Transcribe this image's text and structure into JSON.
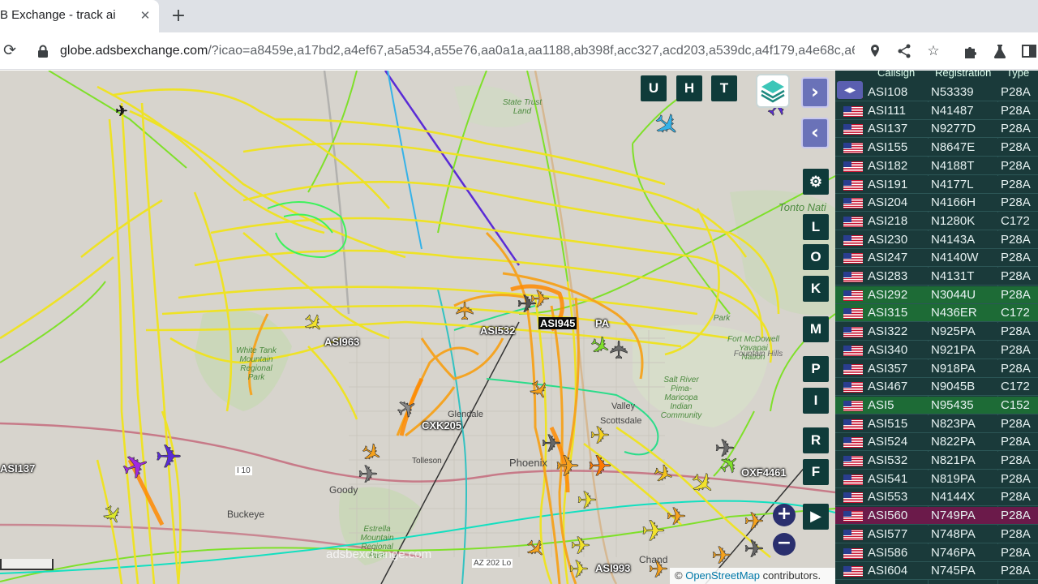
{
  "browser": {
    "tab_title": "B Exchange - track ai",
    "tab_close": "✕",
    "new_tab": "+",
    "url_host": "globe.adsbexchange.com",
    "url_path": "/?icao=a8459e,a17bd2,a4ef67,a5a534,a55e76,aa0a1a,aa1188,ab398f,acc327,acd203,a539dc,a4f179,a4e68c,a6..."
  },
  "map": {
    "watermark": "adsbexchange.com",
    "attribution_prefix": "© ",
    "attribution_link": "OpenStreetMap",
    "attribution_suffix": " contributors.",
    "buttons": {
      "u": "U",
      "h": "H",
      "t": "T",
      "l": "L",
      "o": "O",
      "k": "K",
      "m": "M",
      "p": "P",
      "i": "I",
      "r": "R",
      "f": "F",
      "next": "›",
      "prev": "‹",
      "zoom_in": "+",
      "zoom_out": "−"
    },
    "aircraft_labels": [
      {
        "text": "ASI963"
      },
      {
        "text": "ASI532"
      },
      {
        "text": "ASI945"
      },
      {
        "text": "PA"
      },
      {
        "text": "CXK205"
      },
      {
        "text": "ASI137"
      },
      {
        "text": "OXF4461"
      },
      {
        "text": "ASI993"
      }
    ],
    "places": {
      "state_trust": "State Trust\nLand",
      "tonto": "Tonto Nati",
      "white_tank": "White Tank\nMountain\nRegional\nPark",
      "park": "Park",
      "salt_river": "Salt River\nPima-\nMaricopa\nIndian\nCommunity",
      "fort_mcdowell": "Fort McDowell\nYavapai\nNation",
      "fountain_hills": "Fountain Hills",
      "estrella": "Estrella\nMountain\nRegional\nPark",
      "phoenix": "Phoenix",
      "scottsdale": "Scottsdale",
      "buckeye": "Buckeye",
      "goodyear": "Goody",
      "tolleson": "Tolleson",
      "glendale": "Glendale",
      "valley": "Valley",
      "chandler": "Chand",
      "i10": "I 10",
      "az202": "AZ 202 Lo"
    }
  },
  "table": {
    "headers": {
      "callsign": "Callsign",
      "registration": "Registration",
      "type": "Type"
    },
    "colors": {
      "default": "#1a3a3a",
      "green": "#1d6b36",
      "magenta": "#6b1a4a"
    },
    "rows": [
      {
        "callsign": "ASI108",
        "reg": "N53339",
        "type": "P28A",
        "hl": "default"
      },
      {
        "callsign": "ASI111",
        "reg": "N41487",
        "type": "P28A",
        "hl": "default"
      },
      {
        "callsign": "ASI137",
        "reg": "N9277D",
        "type": "P28A",
        "hl": "default"
      },
      {
        "callsign": "ASI155",
        "reg": "N8647E",
        "type": "P28A",
        "hl": "default"
      },
      {
        "callsign": "ASI182",
        "reg": "N4188T",
        "type": "P28A",
        "hl": "default"
      },
      {
        "callsign": "ASI191",
        "reg": "N4177L",
        "type": "P28A",
        "hl": "default"
      },
      {
        "callsign": "ASI204",
        "reg": "N4166H",
        "type": "P28A",
        "hl": "default"
      },
      {
        "callsign": "ASI218",
        "reg": "N1280K",
        "type": "C172",
        "hl": "default"
      },
      {
        "callsign": "ASI230",
        "reg": "N4143A",
        "type": "P28A",
        "hl": "default"
      },
      {
        "callsign": "ASI247",
        "reg": "N4140W",
        "type": "P28A",
        "hl": "default"
      },
      {
        "callsign": "ASI283",
        "reg": "N4131T",
        "type": "P28A",
        "hl": "default"
      },
      {
        "callsign": "ASI292",
        "reg": "N3044U",
        "type": "P28A",
        "hl": "green"
      },
      {
        "callsign": "ASI315",
        "reg": "N436ER",
        "type": "C172",
        "hl": "green"
      },
      {
        "callsign": "ASI322",
        "reg": "N925PA",
        "type": "P28A",
        "hl": "default"
      },
      {
        "callsign": "ASI340",
        "reg": "N921PA",
        "type": "P28A",
        "hl": "default"
      },
      {
        "callsign": "ASI357",
        "reg": "N918PA",
        "type": "P28A",
        "hl": "default"
      },
      {
        "callsign": "ASI467",
        "reg": "N9045B",
        "type": "C172",
        "hl": "default"
      },
      {
        "callsign": "ASI5",
        "reg": "N95435",
        "type": "C152",
        "hl": "green"
      },
      {
        "callsign": "ASI515",
        "reg": "N823PA",
        "type": "P28A",
        "hl": "default"
      },
      {
        "callsign": "ASI524",
        "reg": "N822PA",
        "type": "P28A",
        "hl": "default"
      },
      {
        "callsign": "ASI532",
        "reg": "N821PA",
        "type": "P28A",
        "hl": "default"
      },
      {
        "callsign": "ASI541",
        "reg": "N819PA",
        "type": "P28A",
        "hl": "default"
      },
      {
        "callsign": "ASI553",
        "reg": "N4144X",
        "type": "P28A",
        "hl": "default"
      },
      {
        "callsign": "ASI560",
        "reg": "N749PA",
        "type": "P28A",
        "hl": "magenta"
      },
      {
        "callsign": "ASI577",
        "reg": "N748PA",
        "type": "P28A",
        "hl": "default"
      },
      {
        "callsign": "ASI586",
        "reg": "N746PA",
        "type": "P28A",
        "hl": "default"
      },
      {
        "callsign": "ASI604",
        "reg": "N745PA",
        "type": "P28A",
        "hl": "default"
      }
    ]
  }
}
